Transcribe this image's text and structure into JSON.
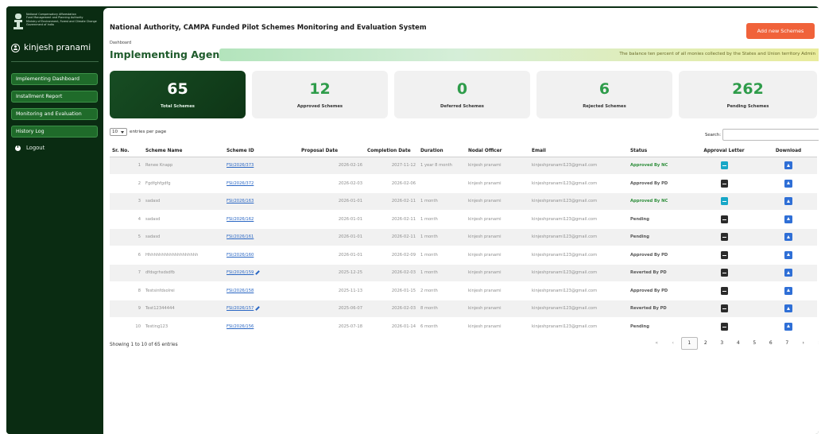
{
  "sidebar": {
    "org_lines": [
      "National Compensatory Afforestation",
      "Fund Management and Planning Authority",
      "Ministry of Environment, Forest and Climate Change",
      "Government of India"
    ],
    "user_name": "kinjesh pranami",
    "nav_items": [
      "Implementing Dashboard",
      "Installment Report",
      "Monitoring and Evaluation",
      "History Log"
    ],
    "logout_label": "Logout"
  },
  "header": {
    "title": "National Authority, CAMPA Funded Pilot Schemes Monitoring and Evaluation System",
    "add_button": "Add new Schemes",
    "breadcrumb": "Dashboard",
    "page_title": "Implementing Agency",
    "marquee_text": "The balance ten percent of all monies collected by the States and Union territory Admin"
  },
  "cards": [
    {
      "value": "65",
      "label": "Total Schemes"
    },
    {
      "value": "12",
      "label": "Approved Schemes"
    },
    {
      "value": "0",
      "label": "Deferred Schemes"
    },
    {
      "value": "6",
      "label": "Rejected Schemes"
    },
    {
      "value": "262",
      "label": "Pending Schemes"
    }
  ],
  "table_controls": {
    "page_size": "10",
    "entries_label": "entries per page",
    "search_label": "Search:"
  },
  "table": {
    "headers": [
      "Sr. No.",
      "Scheme Name",
      "Scheme ID",
      "Proposal Date",
      "Completion Date",
      "Duration",
      "Nodal Officer",
      "Email",
      "Status",
      "Approval Letter",
      "Download"
    ],
    "rows": [
      [
        "1",
        "Renee Knapp",
        "FSI/2026/373",
        "2026-02-16",
        "2027-11-12",
        "1 year 8 month",
        "kinjesh pranami",
        "kinjeshpranami123@gmail.com",
        "Approved By NC"
      ],
      [
        "2",
        "Fgdfghfgdfg",
        "FSI/2026/372",
        "2026-02-03",
        "2026-02-06",
        "",
        "kinjesh pranami",
        "kinjeshpranami123@gmail.com",
        "Approved By PD"
      ],
      [
        "3",
        "sadasd",
        "FSI/2026/163",
        "2026-01-01",
        "2026-02-11",
        "1 month",
        "kinjesh pranami",
        "kinjeshpranami123@gmail.com",
        "Approved By NC"
      ],
      [
        "4",
        "sadasd",
        "FSI/2026/162",
        "2026-01-01",
        "2026-02-11",
        "1 month",
        "kinjesh pranami",
        "kinjeshpranami123@gmail.com",
        "Pending"
      ],
      [
        "5",
        "sadasd",
        "FSI/2026/161",
        "2026-01-01",
        "2026-02-11",
        "1 month",
        "kinjesh pranami",
        "kinjeshpranami123@gmail.com",
        "Pending"
      ],
      [
        "6",
        "Hhhhhhhhhhhhhhhhhhhh",
        "FSI/2026/160",
        "2026-01-01",
        "2026-02-09",
        "1 month",
        "kinjesh pranami",
        "kinjeshpranami123@gmail.com",
        "Approved By PD"
      ],
      [
        "7",
        "dfdsgrhsdsdfb",
        "FSI/2026/159",
        "2025-12-25",
        "2026-02-03",
        "1 month",
        "kinjesh pranami",
        "kinjeshpranami123@gmail.com",
        "Reverted By PD"
      ],
      [
        "8",
        "Testsinfdsolrei",
        "FSI/2026/158",
        "2025-11-13",
        "2026-01-15",
        "2 month",
        "kinjesh pranami",
        "kinjeshpranami123@gmail.com",
        "Approved By PD"
      ],
      [
        "9",
        "Test12344444",
        "FSI/2026/157",
        "2025-06-07",
        "2026-02-03",
        "8 month",
        "kinjesh pranami",
        "kinjeshpranami123@gmail.com",
        "Reverted By PD"
      ],
      [
        "10",
        "Testing123",
        "FSI/2026/156",
        "2025-07-18",
        "2026-01-14",
        "6 month",
        "kinjesh pranami",
        "kinjeshpranami123@gmail.com",
        "Pending"
      ]
    ]
  },
  "footer": {
    "info": "Showing 1 to 10 of 65 entries",
    "pager": [
      "«",
      "‹",
      "1",
      "2",
      "3",
      "4",
      "5",
      "6",
      "7",
      "›",
      "»"
    ]
  }
}
